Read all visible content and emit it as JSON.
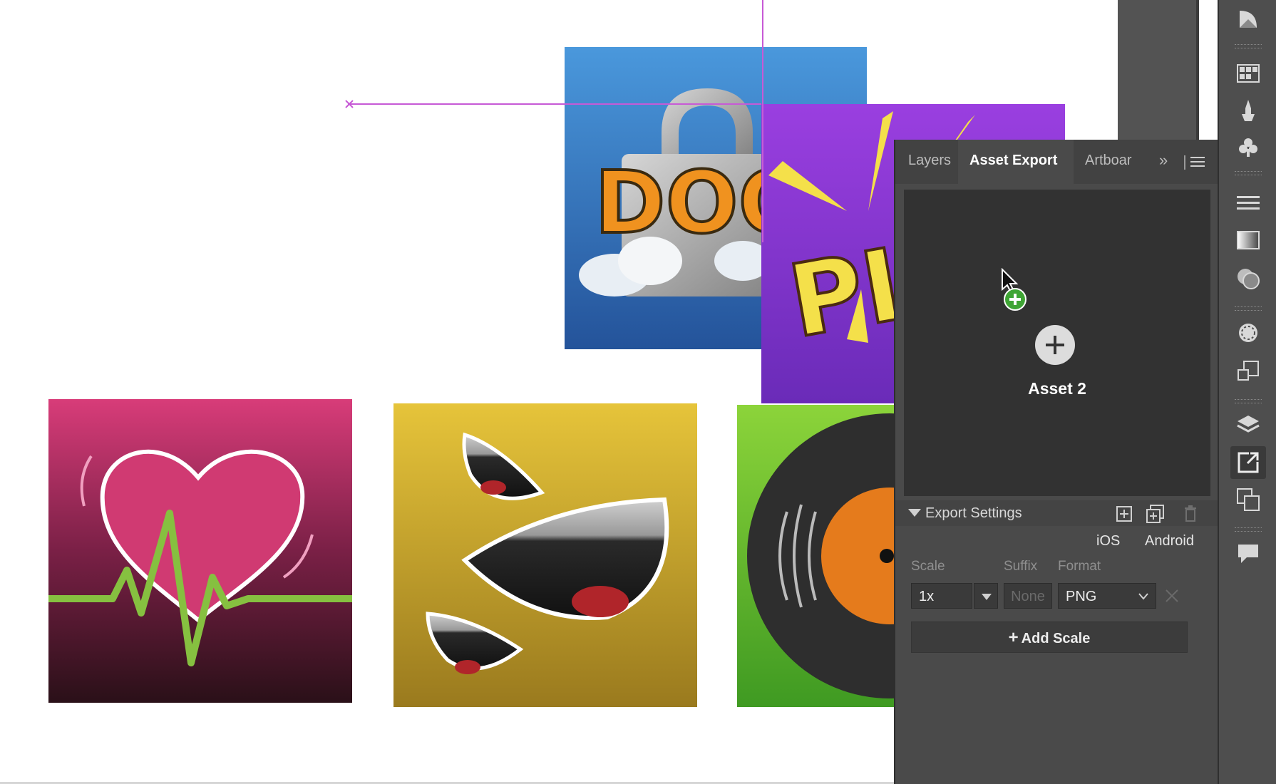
{
  "panel": {
    "tabs": [
      {
        "label": "Layers"
      },
      {
        "label": "Asset Export"
      },
      {
        "label": "Artboar"
      }
    ],
    "overflow_glyph": "»",
    "asset": {
      "name": "Asset 2"
    },
    "export_settings": {
      "title": "Export Settings",
      "platforms": [
        "iOS",
        "Android"
      ],
      "columns": {
        "scale": "Scale",
        "suffix": "Suffix",
        "format": "Format"
      },
      "row": {
        "scale": "1x",
        "suffix_placeholder": "None",
        "format": "PNG"
      },
      "add_scale_label": "Add Scale"
    }
  },
  "artwork": {
    "doom_text": "DOO",
    "pow_text": "PI"
  },
  "icons": [
    "transparency-icon",
    "grid-swatch-icon",
    "brush-icon",
    "club-symbol-icon",
    "stroke-icon",
    "gradient-icon",
    "appearance-icon",
    "color-icon",
    "transform-icon",
    "layers-icon",
    "asset-export-icon",
    "artboards-icon",
    "comment-icon"
  ],
  "colors": {
    "panel_bg": "#4a4a4a",
    "panel_dark": "#323232",
    "guide": "#c75ad6",
    "accent_green": "#3fa535"
  }
}
